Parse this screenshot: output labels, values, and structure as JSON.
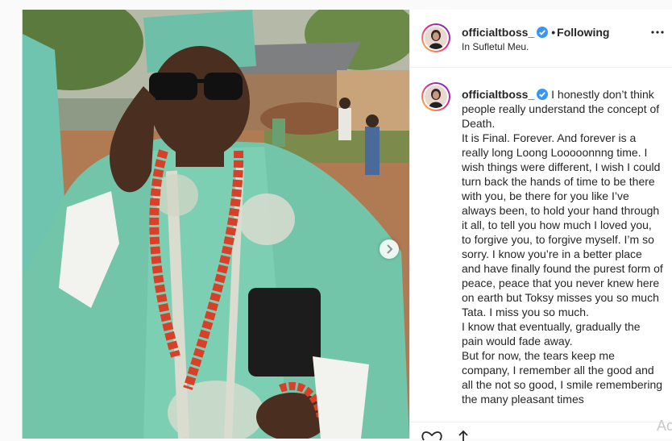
{
  "header": {
    "username": "officialtboss_",
    "separator": "•",
    "follow_state": "Following",
    "location": "In Sufletul Meu."
  },
  "caption": {
    "username": "officialtboss_",
    "first_line": "I honestly don’t think people really understand the concept of Death.",
    "lines": [
      "It is Final. Forever. And forever is a really long Loong Looooonnng time. I wish things were different, I wish I could turn back the hands of time to be there with you, be there for you like I’ve always been, to hold your hand through it all, to tell you how much I loved you, to forgive you, to forgive myself. I’m so sorry. I know you’re in a better place and have finally found the purest form of peace, peace that you never knew here on earth but Toksy misses you so much Tata. I miss you so much.",
      "I know that eventually, gradually the pain would fade away.",
      "But for now, the tears keep me company, I remember all the good and all the not so good, I smile remembering the many pleasant times"
    ]
  },
  "watermark": "Ac",
  "icons": {
    "verified": "verified-badge-icon",
    "more": "more-options-icon",
    "next": "chevron-right-icon",
    "like": "heart-icon",
    "share": "share-icon"
  },
  "colors": {
    "verified": "#3897f0",
    "border": "#dbdbdb",
    "text": "#262626"
  }
}
